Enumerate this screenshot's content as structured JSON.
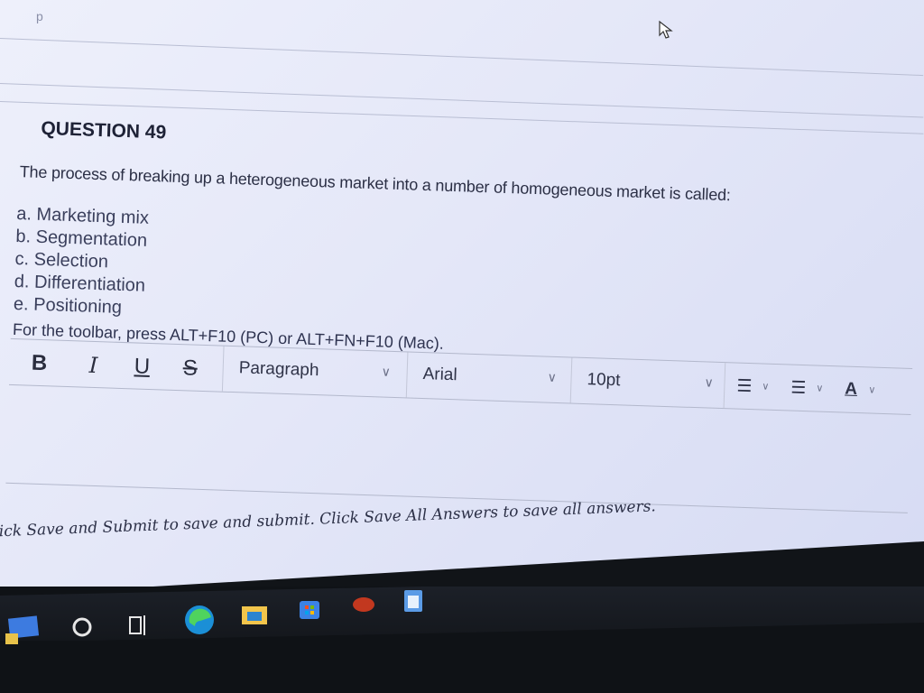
{
  "prev_answer_text": "p",
  "question": {
    "title": "QUESTION 49",
    "text": "The process of breaking up a heterogeneous market into a number of homogeneous market is called:",
    "options": [
      "a. Marketing mix",
      "b. Segmentation",
      "c. Selection",
      "d. Differentiation",
      "e. Positioning"
    ]
  },
  "toolbar": {
    "hint": "For the toolbar, press ALT+F10 (PC) or ALT+FN+F10 (Mac).",
    "bold": "B",
    "italic": "I",
    "underline": "U",
    "strike": "S",
    "paragraph_select": "Paragraph",
    "font_select": "Arial",
    "size_select": "10pt",
    "text_color": "A"
  },
  "footer": {
    "instructions": "Click Save and Submit to save and submit. Click Save All Answers to save all answers."
  },
  "taskbar": {
    "icons": [
      "start-icon",
      "search-circle-icon",
      "task-view-icon",
      "edge-icon",
      "file-explorer-icon",
      "store-icon",
      "app-icon",
      "outlook-icon"
    ]
  },
  "colors": {
    "page_bg": "#e4e7f8",
    "text": "#2b2f45",
    "taskbar": "#0f1216"
  }
}
